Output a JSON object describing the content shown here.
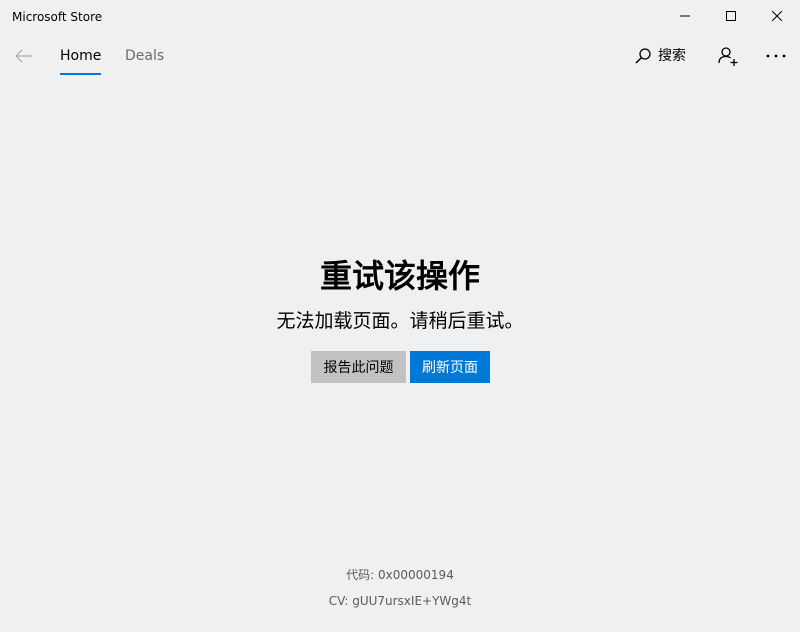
{
  "window": {
    "title": "Microsoft Store"
  },
  "nav": {
    "tabs": [
      {
        "label": "Home",
        "selected": true
      },
      {
        "label": "Deals",
        "selected": false
      }
    ],
    "search_label": "搜索"
  },
  "error": {
    "title": "重试该操作",
    "message": "无法加载页面。请稍后重试。",
    "report_button": "报告此问题",
    "refresh_button": "刷新页面",
    "code_line": "代码: 0x00000194",
    "cv_line": "CV: gUU7ursxIE+YWg4t"
  },
  "colors": {
    "accent": "#0078d7",
    "background": "#f0f0f0",
    "secondary_button": "#c2c2c2"
  },
  "icons": {
    "back": "arrow-left-icon",
    "search": "magnifier-icon",
    "account": "person-add-icon",
    "more": "ellipsis-icon",
    "minimize": "minimize-icon",
    "maximize": "maximize-icon",
    "close": "close-icon"
  }
}
